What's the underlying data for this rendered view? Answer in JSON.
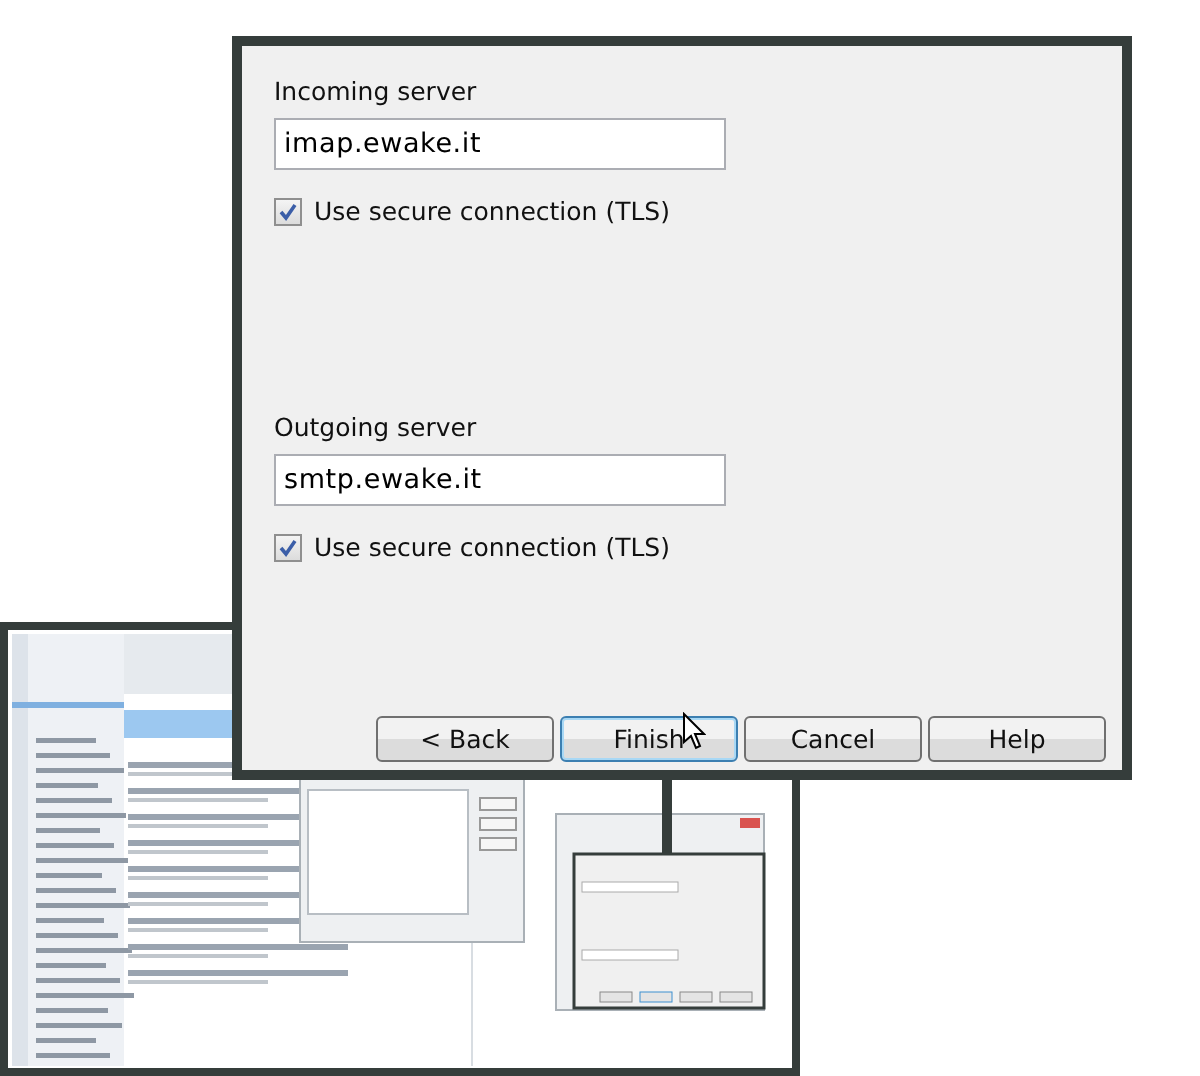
{
  "dialog": {
    "servers": [
      {
        "label": "Incoming server",
        "value": "imap.ewake.it",
        "tls": {
          "label": "Use secure connection (TLS)",
          "checked": true
        }
      },
      {
        "label": "Outgoing server",
        "value": "smtp.ewake.it",
        "tls": {
          "label": "Use secure connection (TLS)",
          "checked": true
        }
      }
    ],
    "buttons": [
      {
        "label": "< Back",
        "selected": false
      },
      {
        "label": "Finish",
        "selected": true
      },
      {
        "label": "Cancel",
        "selected": false
      },
      {
        "label": "Help",
        "selected": false
      }
    ]
  }
}
